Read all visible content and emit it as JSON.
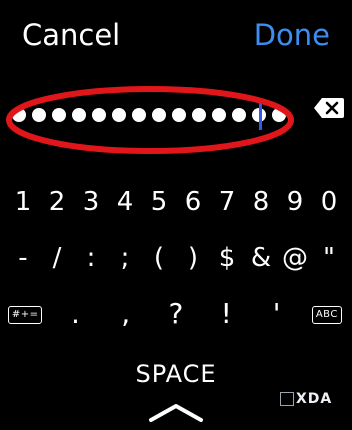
{
  "topbar": {
    "cancel_label": "Cancel",
    "done_label": "Done"
  },
  "colors": {
    "accent": "#3d8ef0",
    "annotation": "#e0161b",
    "caret": "#3b55e6",
    "background": "#000000"
  },
  "password_field": {
    "masked_char_count": 14
  },
  "delete_key": {
    "icon": "backspace-icon"
  },
  "keyboard": {
    "row1": [
      "1",
      "2",
      "3",
      "4",
      "5",
      "6",
      "7",
      "8",
      "9",
      "0"
    ],
    "row2": [
      "-",
      "/",
      ":",
      ";",
      "(",
      ")",
      "$",
      "&",
      "@",
      "\""
    ],
    "row3": {
      "left_mode": "#+=",
      "keys": [
        ".",
        ",",
        "?",
        "!",
        "'"
      ],
      "right_mode": "ABC"
    },
    "space_label": "SPACE",
    "dismiss_icon": "chevron-up-icon"
  },
  "watermark": {
    "text": "XDA"
  }
}
